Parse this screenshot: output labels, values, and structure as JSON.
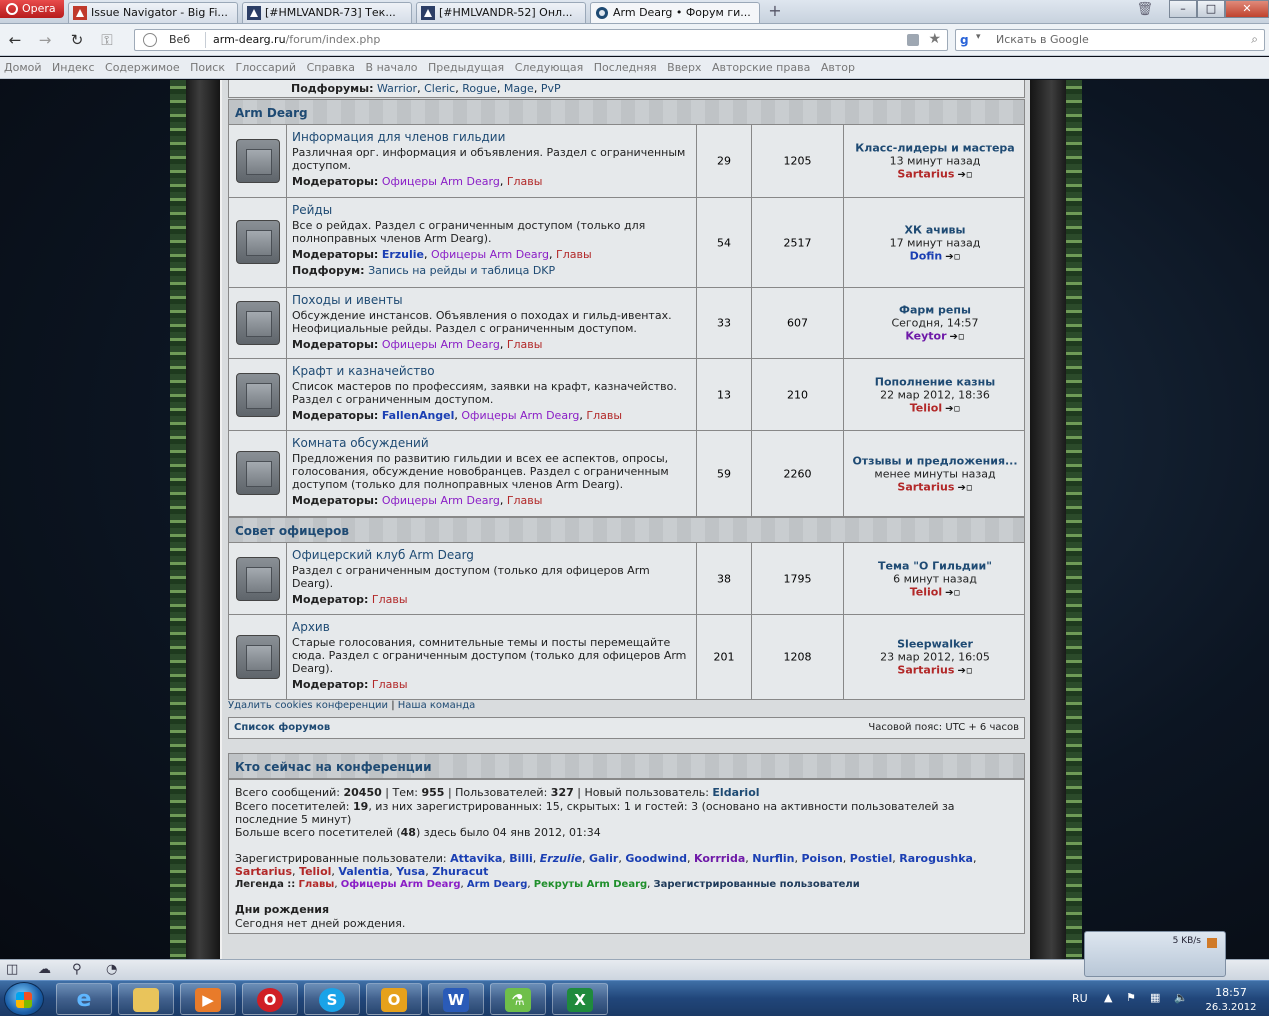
{
  "browser": {
    "menu_label": "Opera",
    "tabs": [
      {
        "label": "Issue Navigator - Big Fi..."
      },
      {
        "label": "[#HMLVANDR-73] Тек..."
      },
      {
        "label": "[#HMLVANDR-52] Онл..."
      },
      {
        "label": "Arm Dearg • Форум ги..."
      }
    ],
    "new_tab": "+",
    "address": {
      "mode": "Веб",
      "host": "arm-dearg.ru",
      "path": "/forum/index.php"
    },
    "search": {
      "engine": "g",
      "placeholder": "Искать в Google"
    },
    "nav_links": [
      "Домой",
      "Индекс",
      "Содержимое",
      "Поиск",
      "Глоссарий",
      "Справка",
      "В начало",
      "Предыдущая",
      "Следующая",
      "Последняя",
      "Вверх",
      "Авторские права",
      "Автор"
    ]
  },
  "forum": {
    "subforums_label": "Подфорумы:",
    "subforums": [
      "Warrior",
      "Cleric",
      "Rogue",
      "Mage",
      "PvP"
    ],
    "categories": [
      {
        "title": "Arm Dearg"
      },
      {
        "title": "Совет офицеров"
      }
    ],
    "labels": {
      "moderators": "Модераторы:",
      "moderator": "Модератор:",
      "subforum": "Подфорум:",
      "officers": "Офицеры Arm Dearg",
      "heads": "Главы",
      "comma": ",",
      "goto": "➔▫"
    },
    "rows": [
      {
        "title": "Информация для членов гильдии",
        "desc": "Различная орг. информация и объявления. Раздел с ограниченным доступом.",
        "topics": "29",
        "posts": "1205",
        "last_title": "Класс-лидеры и мастера",
        "last_time": "13 минут назад",
        "last_user": "Sartarius"
      },
      {
        "title": "Рейды",
        "desc": "Все о рейдах. Раздел с ограниченным доступом (только для полноправных членов Arm Dearg).",
        "extra_mod": "Erzulie",
        "subforum": "Запись на рейды и таблица DKP",
        "topics": "54",
        "posts": "2517",
        "last_title": "ХК ачивы",
        "last_time": "17 минут назад",
        "last_user": "Dofin"
      },
      {
        "title": "Походы и ивенты",
        "desc": "Обсуждение инстансов. Объявления о походах и гильд-ивентах. Неофициальные рейды. Раздел с ограниченным доступом.",
        "topics": "33",
        "posts": "607",
        "last_title": "Фарм репы",
        "last_time": "Сегодня, 14:57",
        "last_user": "Keytor"
      },
      {
        "title": "Крафт и казначейство",
        "desc": "Список мастеров по профессиям, заявки на крафт, казначейство. Раздел с ограниченным доступом.",
        "extra_mod": "FallenAngel",
        "topics": "13",
        "posts": "210",
        "last_title": "Пополнение казны",
        "last_time": "22 мар 2012, 18:36",
        "last_user": "Teliol"
      },
      {
        "title": "Комната обсуждений",
        "desc": "Предложения по развитию гильдии и всех ее аспектов, опросы, голосования, обсуждение новобранцев. Раздел с ограниченным доступом (только для полноправных членов Arm Dearg).",
        "topics": "59",
        "posts": "2260",
        "last_title": "Отзывы и предложения...",
        "last_time": "менее минуты назад",
        "last_user": "Sartarius"
      },
      {
        "title": "Офицерский клуб Arm Dearg",
        "desc": "Раздел с ограниченным доступом (только для офицеров Arm Dearg).",
        "topics": "38",
        "posts": "1795",
        "last_title": "Тема \"О Гильдии\"",
        "last_time": "6 минут назад",
        "last_user": "Teliol"
      },
      {
        "title": "Архив",
        "desc": "Старые голосования, сомнительные темы и посты перемещайте сюда. Раздел с ограниченным доступом (только для офицеров Arm Dearg).",
        "topics": "201",
        "posts": "1208",
        "last_title": "Sleepwalker",
        "last_time": "23 мар 2012, 16:05",
        "last_user": "Sartarius"
      }
    ],
    "footer_links": {
      "delete_cookies": "Удалить cookies конференции",
      "sep": "|",
      "team": "Наша команда"
    },
    "bar": {
      "forum_list": "Список форумов",
      "timezone": "Часовой пояс: UTC + 6 часов"
    },
    "who": {
      "title": "Кто сейчас на конференции",
      "stats_prefix": "Всего сообщений:",
      "messages": "20450",
      "topics_label": "| Тем:",
      "topics": "955",
      "users_label": "| Пользователей:",
      "users": "327",
      "newuser_label": "| Новый пользователь:",
      "newuser": "Eldariol",
      "visitors_prefix": "Всего посетителей:",
      "visitors": "19",
      "visitors_rest": ", из них зарегистрированных: 15, скрытых: 1 и гостей: 3 (основано на активности пользователей за последние 5 минут)",
      "max_prefix": "Больше всего посетителей (",
      "max": "48",
      "max_rest": ") здесь было 04 янв 2012, 01:34",
      "registered_label": "Зарегистрированные пользователи:",
      "registered": [
        "Attavika",
        "Billi",
        "Erzulie",
        "Galir",
        "Goodwind",
        "Korrrida",
        "Nurflin",
        "Poison",
        "Postiel",
        "Rarogushka",
        "Sartarius",
        "Teliol",
        "Valentia",
        "Yusa",
        "Zhuracut"
      ],
      "legend_label": "Легенда ::",
      "legend": [
        "Главы",
        "Офицеры Arm Dearg",
        "Arm Dearg",
        "Рекруты Arm Dearg",
        "Зарегистрированные пользователи"
      ],
      "birthdays_title": "Дни рождения",
      "birthdays_text": "Сегодня нет дней рождения."
    }
  },
  "widget": {
    "speed": "5 KB/s"
  },
  "taskbar": {
    "lang": "RU",
    "time": "18:57",
    "date": "26.3.2012"
  },
  "colors": {
    "link": "#1e4a73",
    "officers": "#8a1ec6",
    "heads": "#b22828",
    "members": "#1b3fb3",
    "recruits": "#1f8f2b"
  }
}
